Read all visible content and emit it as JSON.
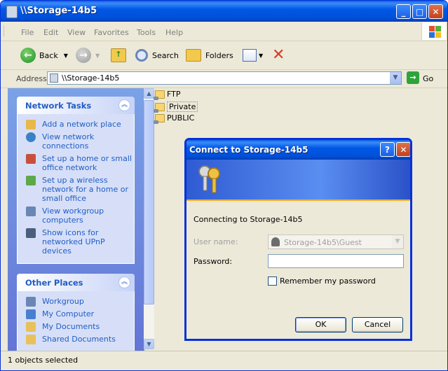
{
  "window": {
    "title": "\\\\Storage-14b5"
  },
  "menu": [
    "File",
    "Edit",
    "View",
    "Favorites",
    "Tools",
    "Help"
  ],
  "toolbar": {
    "back": "Back",
    "search": "Search",
    "folders": "Folders"
  },
  "address": {
    "label": "Address",
    "value": "\\\\Storage-14b5",
    "go": "Go"
  },
  "tasks": {
    "network_title": "Network Tasks",
    "network_items": [
      "Add a network place",
      "View network connections",
      "Set up a home or small office network",
      "Set up a wireless network for a home or small office",
      "View workgroup computers",
      "Show icons for networked UPnP devices"
    ],
    "places_title": "Other Places",
    "places_items": [
      "Workgroup",
      "My Computer",
      "My Documents",
      "Shared Documents"
    ]
  },
  "files": [
    "FTP",
    "Private",
    "PUBLIC"
  ],
  "status": {
    "text": "1 objects selected"
  },
  "dialog": {
    "title": "Connect to Storage-14b5",
    "help": "?",
    "message": "Connecting to Storage-14b5",
    "username_label": "User name:",
    "username_value": "Storage-14b5\\Guest",
    "password_label": "Password:",
    "password_value": "",
    "remember_label": "Remember my password",
    "ok": "OK",
    "cancel": "Cancel"
  },
  "colors": {
    "title_blue": "#0058e6",
    "task_link": "#215dc6",
    "go_green": "#2fa33b",
    "stop_red": "#d63c2a"
  }
}
